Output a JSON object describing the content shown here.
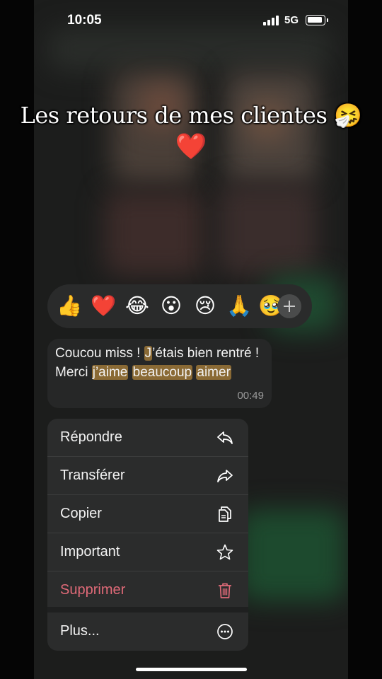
{
  "status_bar": {
    "time": "10:05",
    "network": "5G"
  },
  "caption": {
    "line1": "Les retours de mes clientes 🤧",
    "line2": "❤️"
  },
  "reactions": [
    "👍",
    "❤️",
    "😂",
    "😮",
    "😢",
    "🙏",
    "🥹"
  ],
  "message": {
    "parts": [
      "Coucou miss ! ",
      "J",
      "’étais bien rentré ! Merci ",
      "j’aime",
      " ",
      "beaucoup",
      " ",
      "aimer"
    ],
    "highlight_color": "#8a6a35",
    "time": "00:49"
  },
  "menu": {
    "items": [
      {
        "label": "Répondre",
        "icon": "reply-icon"
      },
      {
        "label": "Transférer",
        "icon": "forward-icon"
      },
      {
        "label": "Copier",
        "icon": "copy-icon"
      },
      {
        "label": "Important",
        "icon": "star-icon"
      },
      {
        "label": "Supprimer",
        "icon": "trash-icon",
        "color": "#e06a78"
      },
      {
        "label": "Plus...",
        "icon": "more-icon"
      }
    ]
  }
}
